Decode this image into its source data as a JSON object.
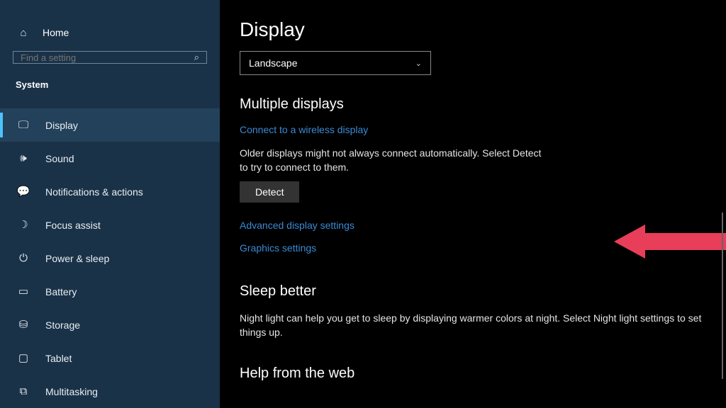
{
  "sidebar": {
    "home": "Home",
    "search_placeholder": "Find a setting",
    "category": "System",
    "items": [
      {
        "label": "Display"
      },
      {
        "label": "Sound"
      },
      {
        "label": "Notifications & actions"
      },
      {
        "label": "Focus assist"
      },
      {
        "label": "Power & sleep"
      },
      {
        "label": "Battery"
      },
      {
        "label": "Storage"
      },
      {
        "label": "Tablet"
      },
      {
        "label": "Multitasking"
      }
    ]
  },
  "main": {
    "title": "Display",
    "orientation_value": "Landscape",
    "sections": {
      "multiple_displays": {
        "heading": "Multiple displays",
        "wireless_link": "Connect to a wireless display",
        "detect_hint": "Older displays might not always connect automatically. Select Detect to try to connect to them.",
        "detect_button": "Detect",
        "advanced_link": "Advanced display settings",
        "graphics_link": "Graphics settings"
      },
      "sleep_better": {
        "heading": "Sleep better",
        "body": "Night light can help you get to sleep by displaying warmer colors at night. Select Night light settings to set things up."
      },
      "help": {
        "heading": "Help from the web"
      }
    }
  }
}
